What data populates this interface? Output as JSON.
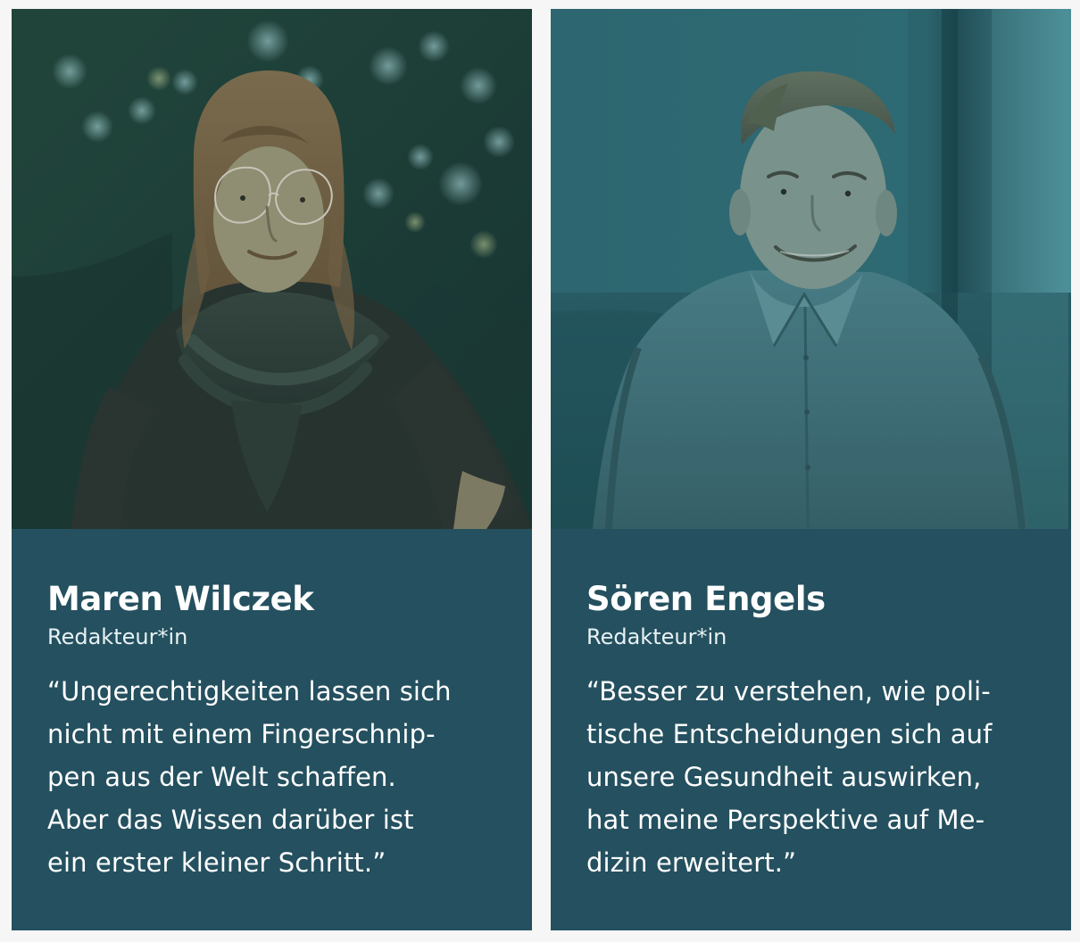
{
  "cards": [
    {
      "name": "Maren Wilczek",
      "role": "Redakteur*in",
      "quote_lines": [
        "“Ungerechtigkeiten lassen sich",
        "nicht mit einem Fingerschnip-",
        "pen aus der Welt schaffen.",
        "Aber das Wissen darüber ist",
        "ein erster kleiner Schritt.”"
      ]
    },
    {
      "name": "Sören Engels",
      "role": "Redakteur*in",
      "quote_lines": [
        "“Besser zu verstehen, wie poli-",
        "tische Entscheidungen sich auf",
        "unsere Gesundheit auswirken,",
        "hat meine Perspektive auf Me-",
        "dizin erweitert.”"
      ]
    }
  ],
  "colors": {
    "page_background": "#f6f6f7",
    "card_background": "#24505f",
    "text": "#ffffff"
  }
}
